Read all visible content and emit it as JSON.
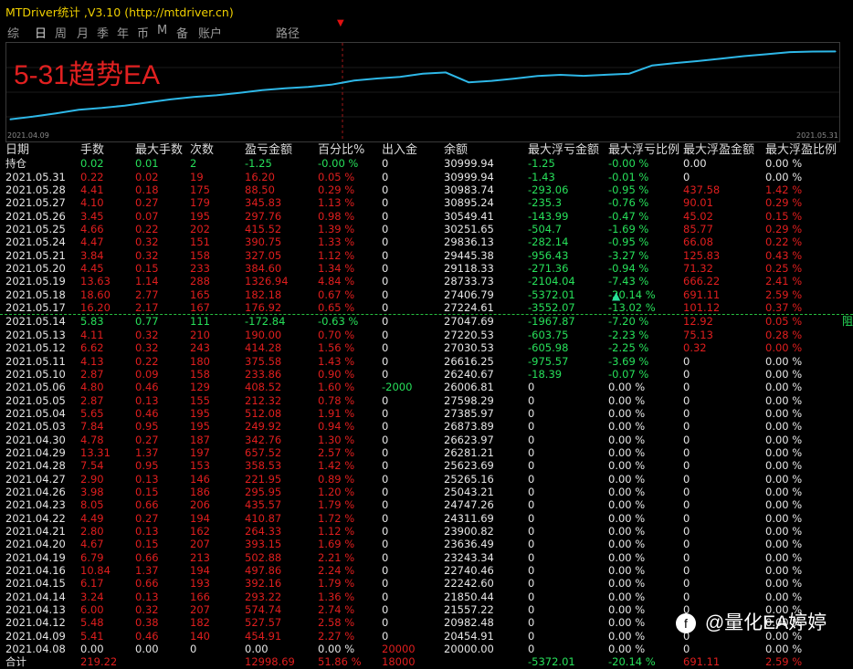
{
  "app": {
    "title": "MTDriver统计 ,V3.10 (http://mtdriver.cn)"
  },
  "menu": [
    "综",
    "日",
    "周",
    "月",
    "季",
    "年",
    "币",
    "M",
    "备",
    "账户",
    "路径"
  ],
  "chart": {
    "title": "5-31趋势EA",
    "start_date": "2021.04.09",
    "end_date": "2021.05.31",
    "line_color": "#2eb8e8"
  },
  "chart_data": {
    "type": "line",
    "x": [
      "2021.04.08",
      "2021.04.09",
      "2021.04.12",
      "2021.04.13",
      "2021.04.14",
      "2021.04.15",
      "2021.04.16",
      "2021.04.19",
      "2021.04.20",
      "2021.04.21",
      "2021.04.22",
      "2021.04.23",
      "2021.04.26",
      "2021.04.27",
      "2021.04.28",
      "2021.04.29",
      "2021.04.30",
      "2021.05.03",
      "2021.05.04",
      "2021.05.05",
      "2021.05.06",
      "2021.05.10",
      "2021.05.11",
      "2021.05.12",
      "2021.05.13",
      "2021.05.14",
      "2021.05.17",
      "2021.05.18",
      "2021.05.19",
      "2021.05.20",
      "2021.05.21",
      "2021.05.24",
      "2021.05.25",
      "2021.05.26",
      "2021.05.27",
      "2021.05.28",
      "2021.05.31"
    ],
    "y": [
      20000,
      20454.91,
      20982.48,
      21557.22,
      21850.44,
      22242.6,
      22740.46,
      23243.34,
      23636.49,
      23900.82,
      24311.69,
      24747.26,
      25043.21,
      25265.16,
      25623.69,
      26281.21,
      26623.97,
      26873.89,
      27385.97,
      27598.29,
      26006.81,
      26240.67,
      26616.25,
      27030.53,
      27220.53,
      27047.69,
      27224.61,
      27406.79,
      28733.73,
      29118.33,
      29445.38,
      29836.13,
      30251.65,
      30549.41,
      30895.24,
      30983.74,
      30999.94
    ]
  },
  "headers": [
    "日期",
    "手数",
    "最大手数",
    "次数",
    "盈亏金额",
    "百分比%",
    "出入金",
    "余额",
    "最大浮亏金额",
    "最大浮亏比例",
    "最大浮盈金额",
    "最大浮盈比例"
  ],
  "rows": [
    {
      "c": [
        "持仓",
        "0.02",
        "0.01",
        "2",
        "-1.25",
        "-0.00 %",
        "0",
        "30999.94",
        "-1.25",
        "-0.00 %",
        "0.00",
        "0.00 %"
      ],
      "k": [
        "w",
        "g",
        "g",
        "g",
        "g",
        "g",
        "w",
        "w",
        "g",
        "g",
        "w",
        "w"
      ]
    },
    {
      "c": [
        "2021.05.31",
        "0.22",
        "0.02",
        "19",
        "16.20",
        "0.05 %",
        "0",
        "30999.94",
        "-1.43",
        "-0.01 %",
        "0",
        "0.00 %"
      ],
      "k": [
        "w",
        "r",
        "r",
        "r",
        "r",
        "r",
        "w",
        "w",
        "g",
        "g",
        "w",
        "w"
      ]
    },
    {
      "c": [
        "2021.05.28",
        "4.41",
        "0.18",
        "175",
        "88.50",
        "0.29 %",
        "0",
        "30983.74",
        "-293.06",
        "-0.95 %",
        "437.58",
        "1.42 %"
      ],
      "k": [
        "w",
        "r",
        "r",
        "r",
        "r",
        "r",
        "w",
        "w",
        "g",
        "g",
        "r",
        "r"
      ]
    },
    {
      "c": [
        "2021.05.27",
        "4.10",
        "0.27",
        "179",
        "345.83",
        "1.13 %",
        "0",
        "30895.24",
        "-235.3",
        "-0.76 %",
        "90.01",
        "0.29 %"
      ],
      "k": [
        "w",
        "r",
        "r",
        "r",
        "r",
        "r",
        "w",
        "w",
        "g",
        "g",
        "r",
        "r"
      ]
    },
    {
      "c": [
        "2021.05.26",
        "3.45",
        "0.07",
        "195",
        "297.76",
        "0.98 %",
        "0",
        "30549.41",
        "-143.99",
        "-0.47 %",
        "45.02",
        "0.15 %"
      ],
      "k": [
        "w",
        "r",
        "r",
        "r",
        "r",
        "r",
        "w",
        "w",
        "g",
        "g",
        "r",
        "r"
      ]
    },
    {
      "c": [
        "2021.05.25",
        "4.66",
        "0.22",
        "202",
        "415.52",
        "1.39 %",
        "0",
        "30251.65",
        "-504.7",
        "-1.69 %",
        "85.77",
        "0.29 %"
      ],
      "k": [
        "w",
        "r",
        "r",
        "r",
        "r",
        "r",
        "w",
        "w",
        "g",
        "g",
        "r",
        "r"
      ]
    },
    {
      "c": [
        "2021.05.24",
        "4.47",
        "0.32",
        "151",
        "390.75",
        "1.33 %",
        "0",
        "29836.13",
        "-282.14",
        "-0.95 %",
        "66.08",
        "0.22 %"
      ],
      "k": [
        "w",
        "r",
        "r",
        "r",
        "r",
        "r",
        "w",
        "w",
        "g",
        "g",
        "r",
        "r"
      ]
    },
    {
      "c": [
        "2021.05.21",
        "3.84",
        "0.32",
        "158",
        "327.05",
        "1.12 %",
        "0",
        "29445.38",
        "-956.43",
        "-3.27 %",
        "125.83",
        "0.43 %"
      ],
      "k": [
        "w",
        "r",
        "r",
        "r",
        "r",
        "r",
        "w",
        "w",
        "g",
        "g",
        "r",
        "r"
      ]
    },
    {
      "c": [
        "2021.05.20",
        "4.45",
        "0.15",
        "233",
        "384.60",
        "1.34 %",
        "0",
        "29118.33",
        "-271.36",
        "-0.94 %",
        "71.32",
        "0.25 %"
      ],
      "k": [
        "w",
        "r",
        "r",
        "r",
        "r",
        "r",
        "w",
        "w",
        "g",
        "g",
        "r",
        "r"
      ]
    },
    {
      "c": [
        "2021.05.19",
        "13.63",
        "1.14",
        "288",
        "1326.94",
        "4.84 %",
        "0",
        "28733.73",
        "-2104.04",
        "-7.43 %",
        "666.22",
        "2.41 %"
      ],
      "k": [
        "w",
        "r",
        "r",
        "r",
        "r",
        "r",
        "w",
        "w",
        "g",
        "g",
        "r",
        "r"
      ]
    },
    {
      "c": [
        "2021.05.18",
        "18.60",
        "2.77",
        "165",
        "182.18",
        "0.67 %",
        "0",
        "27406.79",
        "-5372.01",
        "-20.14 %",
        "691.11",
        "2.59 %"
      ],
      "k": [
        "w",
        "r",
        "r",
        "r",
        "r",
        "r",
        "w",
        "w",
        "g",
        "g",
        "r",
        "r"
      ]
    },
    {
      "c": [
        "2021.05.17",
        "16.20",
        "2.17",
        "167",
        "176.92",
        "0.65 %",
        "0",
        "27224.61",
        "-3552.07",
        "-13.02 %",
        "101.12",
        "0.37 %"
      ],
      "k": [
        "w",
        "r",
        "r",
        "r",
        "r",
        "r",
        "w",
        "w",
        "g",
        "g",
        "r",
        "r"
      ]
    },
    {
      "c": [
        "2021.05.14",
        "5.83",
        "0.77",
        "111",
        "-172.84",
        "-0.63 %",
        "0",
        "27047.69",
        "-1967.87",
        "-7.20 %",
        "12.92",
        "0.05 %"
      ],
      "k": [
        "w",
        "g",
        "g",
        "g",
        "g",
        "g",
        "w",
        "w",
        "g",
        "g",
        "r",
        "r"
      ]
    },
    {
      "c": [
        "2021.05.13",
        "4.11",
        "0.32",
        "210",
        "190.00",
        "0.70 %",
        "0",
        "27220.53",
        "-603.75",
        "-2.23 %",
        "75.13",
        "0.28 %"
      ],
      "k": [
        "w",
        "r",
        "r",
        "r",
        "r",
        "r",
        "w",
        "w",
        "g",
        "g",
        "r",
        "r"
      ]
    },
    {
      "c": [
        "2021.05.12",
        "6.62",
        "0.32",
        "243",
        "414.28",
        "1.56 %",
        "0",
        "27030.53",
        "-605.98",
        "-2.25 %",
        "0.32",
        "0.00 %"
      ],
      "k": [
        "w",
        "r",
        "r",
        "r",
        "r",
        "r",
        "w",
        "w",
        "g",
        "g",
        "r",
        "r"
      ]
    },
    {
      "c": [
        "2021.05.11",
        "4.13",
        "0.22",
        "180",
        "375.58",
        "1.43 %",
        "0",
        "26616.25",
        "-975.57",
        "-3.69 %",
        "0",
        "0.00 %"
      ],
      "k": [
        "w",
        "r",
        "r",
        "r",
        "r",
        "r",
        "w",
        "w",
        "g",
        "g",
        "w",
        "w"
      ]
    },
    {
      "c": [
        "2021.05.10",
        "2.87",
        "0.09",
        "158",
        "233.86",
        "0.90 %",
        "0",
        "26240.67",
        "-18.39",
        "-0.07 %",
        "0",
        "0.00 %"
      ],
      "k": [
        "w",
        "r",
        "r",
        "r",
        "r",
        "r",
        "w",
        "w",
        "g",
        "g",
        "w",
        "w"
      ]
    },
    {
      "c": [
        "2021.05.06",
        "4.80",
        "0.46",
        "129",
        "408.52",
        "1.60 %",
        "-2000",
        "26006.81",
        "0",
        "0.00 %",
        "0",
        "0.00 %"
      ],
      "k": [
        "w",
        "r",
        "r",
        "r",
        "r",
        "r",
        "g",
        "w",
        "w",
        "w",
        "w",
        "w"
      ]
    },
    {
      "c": [
        "2021.05.05",
        "2.87",
        "0.13",
        "155",
        "212.32",
        "0.78 %",
        "0",
        "27598.29",
        "0",
        "0.00 %",
        "0",
        "0.00 %"
      ],
      "k": [
        "w",
        "r",
        "r",
        "r",
        "r",
        "r",
        "w",
        "w",
        "w",
        "w",
        "w",
        "w"
      ]
    },
    {
      "c": [
        "2021.05.04",
        "5.65",
        "0.46",
        "195",
        "512.08",
        "1.91 %",
        "0",
        "27385.97",
        "0",
        "0.00 %",
        "0",
        "0.00 %"
      ],
      "k": [
        "w",
        "r",
        "r",
        "r",
        "r",
        "r",
        "w",
        "w",
        "w",
        "w",
        "w",
        "w"
      ]
    },
    {
      "c": [
        "2021.05.03",
        "7.84",
        "0.95",
        "195",
        "249.92",
        "0.94 %",
        "0",
        "26873.89",
        "0",
        "0.00 %",
        "0",
        "0.00 %"
      ],
      "k": [
        "w",
        "r",
        "r",
        "r",
        "r",
        "r",
        "w",
        "w",
        "w",
        "w",
        "w",
        "w"
      ]
    },
    {
      "c": [
        "2021.04.30",
        "4.78",
        "0.27",
        "187",
        "342.76",
        "1.30 %",
        "0",
        "26623.97",
        "0",
        "0.00 %",
        "0",
        "0.00 %"
      ],
      "k": [
        "w",
        "r",
        "r",
        "r",
        "r",
        "r",
        "w",
        "w",
        "w",
        "w",
        "w",
        "w"
      ]
    },
    {
      "c": [
        "2021.04.29",
        "13.31",
        "1.37",
        "197",
        "657.52",
        "2.57 %",
        "0",
        "26281.21",
        "0",
        "0.00 %",
        "0",
        "0.00 %"
      ],
      "k": [
        "w",
        "r",
        "r",
        "r",
        "r",
        "r",
        "w",
        "w",
        "w",
        "w",
        "w",
        "w"
      ]
    },
    {
      "c": [
        "2021.04.28",
        "7.54",
        "0.95",
        "153",
        "358.53",
        "1.42 %",
        "0",
        "25623.69",
        "0",
        "0.00 %",
        "0",
        "0.00 %"
      ],
      "k": [
        "w",
        "r",
        "r",
        "r",
        "r",
        "r",
        "w",
        "w",
        "w",
        "w",
        "w",
        "w"
      ]
    },
    {
      "c": [
        "2021.04.27",
        "2.90",
        "0.13",
        "146",
        "221.95",
        "0.89 %",
        "0",
        "25265.16",
        "0",
        "0.00 %",
        "0",
        "0.00 %"
      ],
      "k": [
        "w",
        "r",
        "r",
        "r",
        "r",
        "r",
        "w",
        "w",
        "w",
        "w",
        "w",
        "w"
      ]
    },
    {
      "c": [
        "2021.04.26",
        "3.98",
        "0.15",
        "186",
        "295.95",
        "1.20 %",
        "0",
        "25043.21",
        "0",
        "0.00 %",
        "0",
        "0.00 %"
      ],
      "k": [
        "w",
        "r",
        "r",
        "r",
        "r",
        "r",
        "w",
        "w",
        "w",
        "w",
        "w",
        "w"
      ]
    },
    {
      "c": [
        "2021.04.23",
        "8.05",
        "0.66",
        "206",
        "435.57",
        "1.79 %",
        "0",
        "24747.26",
        "0",
        "0.00 %",
        "0",
        "0.00 %"
      ],
      "k": [
        "w",
        "r",
        "r",
        "r",
        "r",
        "r",
        "w",
        "w",
        "w",
        "w",
        "w",
        "w"
      ]
    },
    {
      "c": [
        "2021.04.22",
        "4.49",
        "0.27",
        "194",
        "410.87",
        "1.72 %",
        "0",
        "24311.69",
        "0",
        "0.00 %",
        "0",
        "0.00 %"
      ],
      "k": [
        "w",
        "r",
        "r",
        "r",
        "r",
        "r",
        "w",
        "w",
        "w",
        "w",
        "w",
        "w"
      ]
    },
    {
      "c": [
        "2021.04.21",
        "2.80",
        "0.13",
        "162",
        "264.33",
        "1.12 %",
        "0",
        "23900.82",
        "0",
        "0.00 %",
        "0",
        "0.00 %"
      ],
      "k": [
        "w",
        "r",
        "r",
        "r",
        "r",
        "r",
        "w",
        "w",
        "w",
        "w",
        "w",
        "w"
      ]
    },
    {
      "c": [
        "2021.04.20",
        "4.67",
        "0.15",
        "207",
        "393.15",
        "1.69 %",
        "0",
        "23636.49",
        "0",
        "0.00 %",
        "0",
        "0.00 %"
      ],
      "k": [
        "w",
        "r",
        "r",
        "r",
        "r",
        "r",
        "w",
        "w",
        "w",
        "w",
        "w",
        "w"
      ]
    },
    {
      "c": [
        "2021.04.19",
        "6.79",
        "0.66",
        "213",
        "502.88",
        "2.21 %",
        "0",
        "23243.34",
        "0",
        "0.00 %",
        "0",
        "0.00 %"
      ],
      "k": [
        "w",
        "r",
        "r",
        "r",
        "r",
        "r",
        "w",
        "w",
        "w",
        "w",
        "w",
        "w"
      ]
    },
    {
      "c": [
        "2021.04.16",
        "10.84",
        "1.37",
        "194",
        "497.86",
        "2.24 %",
        "0",
        "22740.46",
        "0",
        "0.00 %",
        "0",
        "0.00 %"
      ],
      "k": [
        "w",
        "r",
        "r",
        "r",
        "r",
        "r",
        "w",
        "w",
        "w",
        "w",
        "w",
        "w"
      ]
    },
    {
      "c": [
        "2021.04.15",
        "6.17",
        "0.66",
        "193",
        "392.16",
        "1.79 %",
        "0",
        "22242.60",
        "0",
        "0.00 %",
        "0",
        "0.00 %"
      ],
      "k": [
        "w",
        "r",
        "r",
        "r",
        "r",
        "r",
        "w",
        "w",
        "w",
        "w",
        "w",
        "w"
      ]
    },
    {
      "c": [
        "2021.04.14",
        "3.24",
        "0.13",
        "166",
        "293.22",
        "1.36 %",
        "0",
        "21850.44",
        "0",
        "0.00 %",
        "0",
        "0.00 %"
      ],
      "k": [
        "w",
        "r",
        "r",
        "r",
        "r",
        "r",
        "w",
        "w",
        "w",
        "w",
        "w",
        "w"
      ]
    },
    {
      "c": [
        "2021.04.13",
        "6.00",
        "0.32",
        "207",
        "574.74",
        "2.74 %",
        "0",
        "21557.22",
        "0",
        "0.00 %",
        "0",
        "0.00 %"
      ],
      "k": [
        "w",
        "r",
        "r",
        "r",
        "r",
        "r",
        "w",
        "w",
        "w",
        "w",
        "w",
        "w"
      ]
    },
    {
      "c": [
        "2021.04.12",
        "5.48",
        "0.38",
        "182",
        "527.57",
        "2.58 %",
        "0",
        "20982.48",
        "0",
        "0.00 %",
        "0",
        "0.00 %"
      ],
      "k": [
        "w",
        "r",
        "r",
        "r",
        "r",
        "r",
        "w",
        "w",
        "w",
        "w",
        "w",
        "w"
      ]
    },
    {
      "c": [
        "2021.04.09",
        "5.41",
        "0.46",
        "140",
        "454.91",
        "2.27 %",
        "0",
        "20454.91",
        "0",
        "0.00 %",
        "0",
        "0.00 %"
      ],
      "k": [
        "w",
        "r",
        "r",
        "r",
        "r",
        "r",
        "w",
        "w",
        "w",
        "w",
        "w",
        "w"
      ]
    },
    {
      "c": [
        "2021.04.08",
        "0.00",
        "0.00",
        "0",
        "0.00",
        "0.00 %",
        "20000",
        "20000.00",
        "0",
        "0.00 %",
        "0",
        "0.00 %"
      ],
      "k": [
        "w",
        "w",
        "w",
        "w",
        "w",
        "w",
        "r",
        "w",
        "w",
        "w",
        "w",
        "w"
      ]
    },
    {
      "c": [
        "合计",
        "219.22",
        "",
        "",
        "12998.69",
        "51.86 %",
        "18000",
        "",
        "-5372.01",
        "-20.14 %",
        "691.11",
        "2.59 %"
      ],
      "k": [
        "w",
        "r",
        "r",
        "r",
        "r",
        "r",
        "r",
        "w",
        "g",
        "g",
        "r",
        "r"
      ]
    }
  ],
  "side_label": "阻",
  "watermark": {
    "logo": "f",
    "text": "@量化EA婷婷"
  }
}
